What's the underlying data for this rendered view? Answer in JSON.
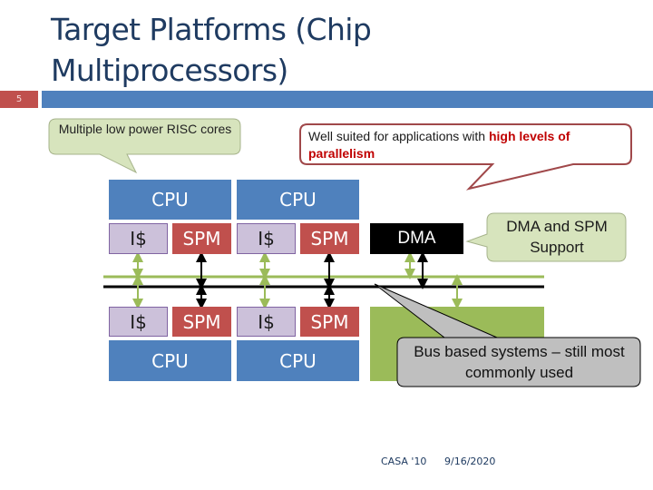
{
  "slide": {
    "title": "Target Platforms (Chip Multiprocessors)",
    "number": "5",
    "footer_left": "CASA '10",
    "footer_right": "9/16/2020"
  },
  "colors": {
    "title_text": "#1f3b61",
    "title_bar": "#4f81bd",
    "slide_number_bg": "#c0504d",
    "cpu": "#4f81bd",
    "icache": "#ccc1da",
    "spm": "#c0504d",
    "dma": "#000000",
    "bus_green": "#9bbb59",
    "bus_black": "#000000",
    "highlight": "#c00000"
  },
  "callouts": {
    "risc": {
      "text": "Multiple low power RISC cores"
    },
    "parallel": {
      "text_plain": "Well suited for applications with ",
      "text_highlight": "high levels of parallelism"
    },
    "dma_spm": {
      "text": "DMA and SPM Support"
    },
    "bus": {
      "text": "Bus based systems – still most commonly used"
    }
  },
  "diagram": {
    "top_cores": [
      {
        "cpu": "CPU",
        "icache": "I$",
        "spm": "SPM"
      },
      {
        "cpu": "CPU",
        "icache": "I$",
        "spm": "SPM"
      }
    ],
    "bottom_cores": [
      {
        "cpu": "CPU",
        "icache": "I$",
        "spm": "SPM"
      },
      {
        "cpu": "CPU",
        "icache": "I$",
        "spm": "SPM"
      }
    ],
    "dma_label": "DMA"
  }
}
